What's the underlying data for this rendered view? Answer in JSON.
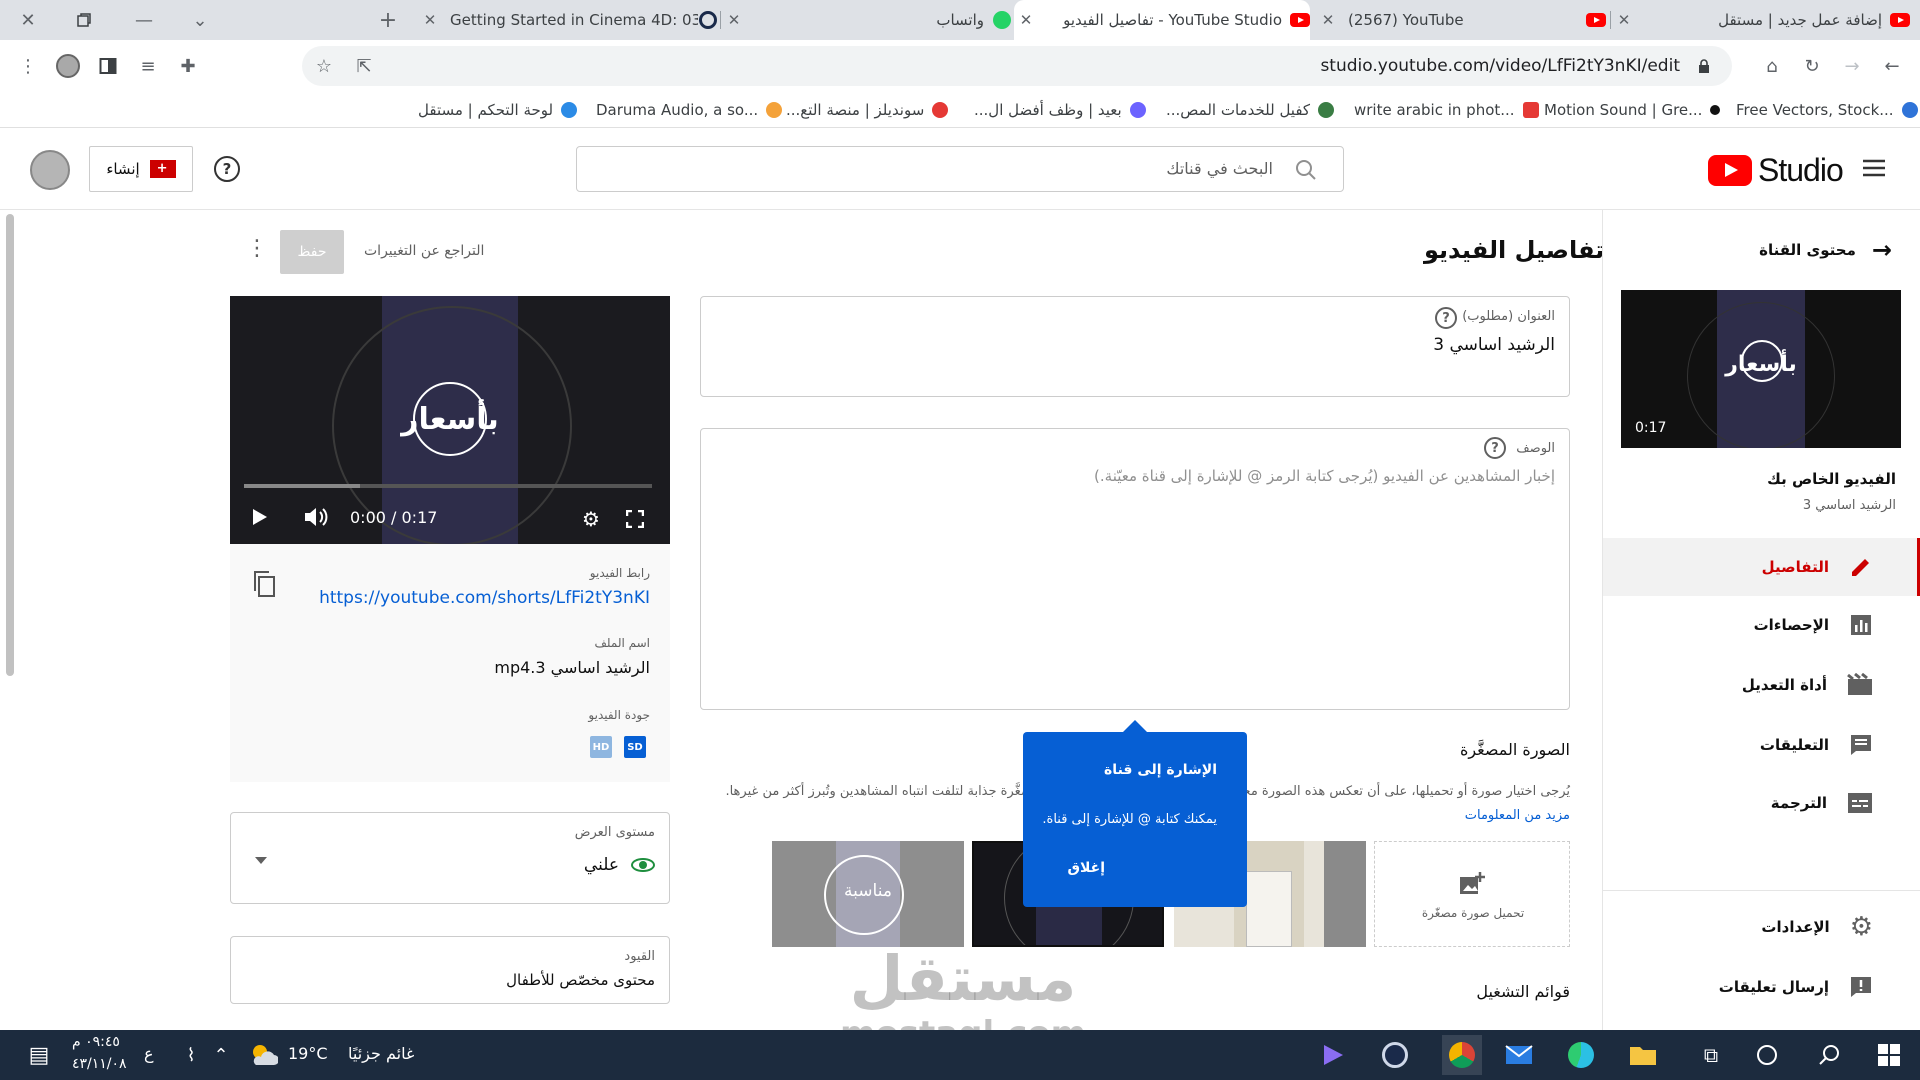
{
  "browser": {
    "tabs": [
      {
        "title": "Getting Started in Cinema 4D: 03",
        "active": false
      },
      {
        "title": "واتساب",
        "active": false
      },
      {
        "title": "YouTube Studio - تفاصيل الفيديو",
        "active": true
      },
      {
        "title": "(2567) YouTube",
        "active": false
      },
      {
        "title": "إضافة عمل جديد | مستقل",
        "active": false
      }
    ],
    "url": "studio.youtube.com/video/LfFi2tY3nKI/edit",
    "bookmarks": [
      {
        "label": "لوحة التحكم | مستقل",
        "color": "#2b8be6"
      },
      {
        "label": "Daruma Audio, a so...",
        "color": "#f4a23a"
      },
      {
        "label": "سونديلز | منصة التع...",
        "color": "#e53935"
      },
      {
        "label": "بعيد | وظف أفضل ال...",
        "color": "#6c63ff"
      },
      {
        "label": "كفيل للخدمات المص...",
        "color": "#3a7d44"
      },
      {
        "label": "write arabic in phot...",
        "color": "#e53935"
      },
      {
        "label": "Motion Sound | Gre...",
        "color": "#111111"
      },
      {
        "label": "Free Vectors, Stock...",
        "color": "#2f73d8"
      }
    ]
  },
  "header": {
    "logo_text": "Studio",
    "search_placeholder": "البحث في قناتك",
    "create_label": "إنشاء"
  },
  "sidebar": {
    "back_label": "محتوى القناة",
    "video_duration": "0:17",
    "your_video_label": "الفيديو الخاص بك",
    "video_title": "الرشيد اساسي 3",
    "thumb_text": "بأسعار",
    "items": [
      {
        "label": "التفاصيل",
        "icon": "pencil-icon",
        "active": true
      },
      {
        "label": "الإحصاءات",
        "icon": "analytics-icon",
        "active": false
      },
      {
        "label": "أداة التعديل",
        "icon": "editor-icon",
        "active": false
      },
      {
        "label": "التعليقات",
        "icon": "comments-icon",
        "active": false
      },
      {
        "label": "الترجمة",
        "icon": "subtitles-icon",
        "active": false
      }
    ],
    "bottom_items": [
      {
        "label": "الإعدادات",
        "icon": "gear-icon"
      },
      {
        "label": "إرسال تعليقات",
        "icon": "feedback-icon"
      }
    ]
  },
  "main": {
    "page_title": "تفاصيل الفيديو",
    "undo_label": "التراجع عن التغييرات",
    "save_label": "حفظ",
    "title_field": {
      "label": "العنوان (مطلوب)",
      "value": "الرشيد اساسي 3"
    },
    "description_field": {
      "label": "الوصف",
      "placeholder": "إخبار المشاهدين عن الفيديو (يُرجى كتابة الرمز @ للإشارة إلى قناة معيّنة.)"
    },
    "thumbnail": {
      "heading": "الصورة المصغَّرة",
      "help_text": "يُرجى اختيار صورة أو تحميلها، على أن تعكس هذه الصورة محتوى الفيديو. يُفضَّل أن تكون الصورة المصغَّرة جذابة لتلفت انتباه المشاهدين وتُبرز أكثر من غيرها.",
      "learn_more": "مزيد من المعلومات",
      "upload_label": "تحميل صورة مصغّرة",
      "auto_thumb_text": "مناسبة"
    },
    "playlists_heading": "قوائم التشغيل"
  },
  "tooltip": {
    "title": "الإشارة إلى قناة",
    "body": "يمكنك كتابة @ للإشارة إلى قناة.",
    "close_label": "إغلاق"
  },
  "preview": {
    "overlay_text": "بأسعار",
    "time": "0:00 / 0:17",
    "link_label": "رابط الفيديو",
    "link_url": "https://youtube.com/shorts/LfFi2tY3nKI",
    "filename_label": "اسم الملف",
    "filename": "الرشيد اساسي 3.mp4",
    "quality_label": "جودة الفيديو",
    "quality_badges": [
      "HD",
      "SD"
    ]
  },
  "visibility": {
    "label": "مستوى العرض",
    "value": "علني"
  },
  "restrictions": {
    "label": "القيود",
    "value": "محتوى مخصّص للأطفال"
  },
  "watermark": {
    "text_ar": "مستقل",
    "text_en": "mostaql.com"
  },
  "taskbar": {
    "time": "٠٩:٤٥ م",
    "date": "٤٣/١١/٠٨",
    "lang": "ع",
    "weather_temp": "19°C",
    "weather_desc": "غائم جزئيًا"
  }
}
